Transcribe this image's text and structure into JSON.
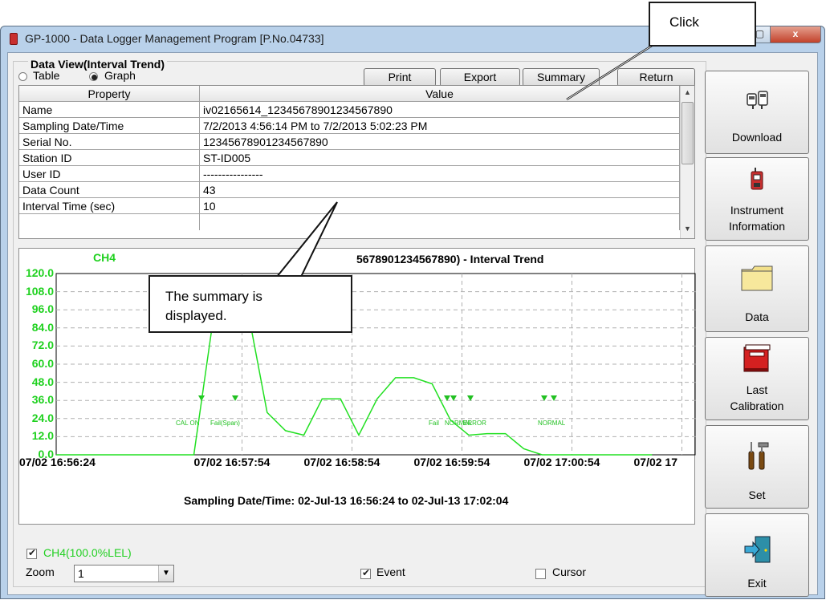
{
  "window": {
    "title": "GP-1000  - Data Logger Management Program [P.No.04733]",
    "close_glyph": "x"
  },
  "data_view": {
    "group_title": "Data View(Interval Trend)",
    "radio_table": "Table",
    "radio_graph": "Graph",
    "buttons": {
      "print": "Print",
      "export": "Export",
      "summary": "Summary",
      "return": "Return"
    }
  },
  "property_table": {
    "headers": [
      "Property",
      "Value"
    ],
    "rows": [
      [
        "Name",
        "iv02165614_12345678901234567890"
      ],
      [
        "Sampling Date/Time",
        "7/2/2013 4:56:14 PM to 7/2/2013 5:02:23 PM"
      ],
      [
        "Serial No.",
        "12345678901234567890"
      ],
      [
        "Station ID",
        "ST-ID005"
      ],
      [
        "User ID",
        "----------------"
      ],
      [
        "Data Count",
        "43"
      ],
      [
        "Interval Time (sec)",
        "10"
      ]
    ]
  },
  "graph": {
    "title_visible": "5678901234567890) - Interval Trend",
    "series_label": "CH4",
    "y_ticks": [
      "120.0",
      "108.0",
      "96.0",
      "84.0",
      "72.0",
      "60.0",
      "48.0",
      "36.0",
      "24.0",
      "12.0",
      "0.0"
    ],
    "x_ticks": [
      "07/02 16:56:24",
      "07/02 16:57:54",
      "07/02 16:58:54",
      "07/02 16:59:54",
      "07/02 17:00:54",
      "07/02 17"
    ],
    "x_caption": "Sampling Date/Time: 02-Jul-13 16:56:24 to 02-Jul-13 17:02:04",
    "event_labels": [
      "CAL ON",
      "Fail(Span)",
      "Fail",
      "NORMAL",
      "ERROR",
      "NORMAL"
    ],
    "line_color": "#22e022",
    "ylim": [
      0,
      120
    ]
  },
  "chart_data": {
    "type": "line",
    "title": "5678901234567890) - Interval Trend",
    "xlabel": "Sampling Date/Time: 02-Jul-13 16:56:24 to 02-Jul-13 17:02:04",
    "ylabel": "CH4",
    "ylim": [
      0,
      120
    ],
    "series": [
      {
        "name": "CH4",
        "x": [
          "16:56:24",
          "16:57:54",
          "16:58:04",
          "16:58:14",
          "16:58:24",
          "16:58:34",
          "16:58:44",
          "16:58:54",
          "16:59:04",
          "16:59:14",
          "16:59:24",
          "16:59:34",
          "16:59:44",
          "16:59:54",
          "17:00:04",
          "17:00:14",
          "17:00:24",
          "17:00:34",
          "17:00:44",
          "17:00:54",
          "17:01:04",
          "17:02:04"
        ],
        "values": [
          0,
          0,
          85,
          100,
          92,
          28,
          16,
          13,
          37,
          37,
          13,
          37,
          51,
          51,
          47,
          23,
          13,
          14,
          14,
          4,
          0,
          0
        ]
      }
    ]
  },
  "sidebar": {
    "download": "Download",
    "instrument_line1": "Instrument",
    "instrument_line2": "Information",
    "data": "Data",
    "calibration_line1": "Last",
    "calibration_line2": "Calibration",
    "set": "Set",
    "exit": "Exit"
  },
  "bottom": {
    "ch4_checkbox": "CH4(100.0%LEL)",
    "zoom_label": "Zoom",
    "zoom_value": "1",
    "event_checkbox": "Event",
    "cursor_checkbox": "Cursor"
  },
  "callouts": {
    "click": "Click",
    "summary_line1": "The summary is",
    "summary_line2": "displayed."
  },
  "colors": {
    "ch4_green": "#22e022",
    "titlebar": "#b9d1ea",
    "icon_red": "#c82f2f",
    "folder_yellow": "#f2e08a"
  }
}
